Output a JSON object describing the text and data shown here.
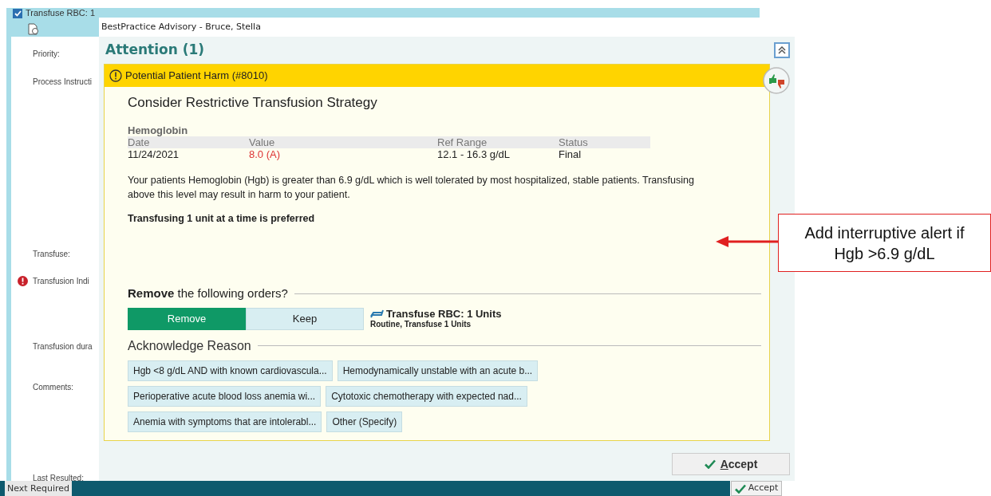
{
  "order_form": {
    "title": "Transfuse RBC: 1",
    "checked": true,
    "fields": [
      {
        "label": "Priority:",
        "kind": "plain"
      },
      {
        "label": "Process Instructi",
        "kind": "plain"
      },
      {
        "label": "Transfuse:",
        "kind": "plain"
      },
      {
        "label": "Transfusion Indi",
        "kind": "required"
      },
      {
        "label": "Transfusion dura",
        "kind": "plain"
      },
      {
        "label": "Comments:",
        "kind": "plain"
      },
      {
        "label": "Last Resulted:",
        "kind": "plain"
      }
    ],
    "next_required": "Next Required",
    "accept": "Accept"
  },
  "advisory": {
    "window_title": "BestPractice Advisory - Bruce, Stella",
    "heading": "Attention (1)",
    "alert": {
      "category": "Potential Patient Harm (#8010)",
      "title": "Consider Restrictive Transfusion Strategy",
      "lab": {
        "name": "Hemoglobin",
        "columns": [
          "Date",
          "Value",
          "Ref Range",
          "Status"
        ],
        "rows": [
          {
            "date": "11/24/2021",
            "value": "8.0 (A)",
            "abnormal": true,
            "ref_range": "12.1 - 16.3 g/dL",
            "status": "Final"
          }
        ]
      },
      "message": "Your patients Hemoglobin (Hgb) is greater than 6.9 g/dL which is well tolerated by most hospitalized, stable patients. Transfusing above this level may result in harm to your patient.",
      "emphasis": "Transfusing 1 unit at a time is preferred",
      "orders_question": "**Remove** the following orders?",
      "order_actions": [
        {
          "label": "Remove",
          "selected": true
        },
        {
          "label": "Keep",
          "selected": false
        }
      ],
      "order": {
        "name": "Transfuse RBC: 1 Units",
        "details": "Routine, Transfuse 1 Units"
      },
      "reason_heading": "Acknowledge Reason",
      "reasons": [
        [
          {
            "label": "Hgb <8 g/dL AND with known cardiovascula...",
            "selected": false
          },
          {
            "label": "Hemodynamically unstable with an acute b...",
            "selected": false
          }
        ],
        [
          {
            "label": "Perioperative acute blood loss anemia wi...",
            "selected": false
          },
          {
            "label": "Cytotoxic chemotherapy with expected nad...",
            "selected": false
          }
        ],
        [
          {
            "label": "Anemia with symptoms that are intolerabl...",
            "selected": false
          },
          {
            "label": "Other (Specify)",
            "selected": false
          }
        ]
      ]
    },
    "accept": {
      "mnemonic": "A",
      "rest": "ccept"
    }
  },
  "annotation": "Add interruptive alert if Hgb >6.9 g/dL"
}
